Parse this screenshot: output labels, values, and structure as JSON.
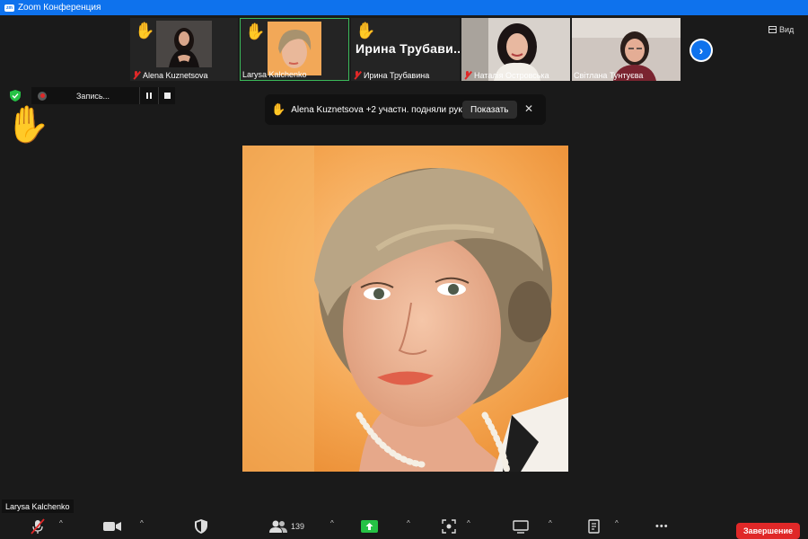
{
  "window": {
    "logo": "zm",
    "title": "Zoom Конференция"
  },
  "gallery": [
    {
      "name": "Alena Kuznetsova",
      "hand": "✋",
      "muted": true
    },
    {
      "name": "Larysa Kalchenko",
      "hand": "✋",
      "muted": false,
      "active": true
    },
    {
      "name": "Ирина Трубавина",
      "hand": "✋",
      "muted": true,
      "big_label": "Ирина Трубави..."
    },
    {
      "name": "Наталія Островська",
      "muted": true
    },
    {
      "name": "Світлана Тунтуєва",
      "muted": false
    }
  ],
  "view_button": {
    "label": "Вид",
    "icon": "grid-view-icon"
  },
  "next_button": {
    "icon": "chevron-right-icon",
    "glyph": "›"
  },
  "recording": {
    "label": "Запись..."
  },
  "raised_hand": "✋",
  "notification": {
    "hand": "✋",
    "text": "Alena Kuznetsova +2 участн. подняли руку",
    "button": "Показать",
    "close": "✕"
  },
  "speaker": {
    "name": "Larysa Kalchenko"
  },
  "toolbar": {
    "participants_count": "139",
    "caret": "^",
    "more": "•••",
    "end_label": "Завершение"
  },
  "colors": {
    "titlebar": "#0e72ed",
    "active_border": "#3bba5a",
    "muted": "#e02828",
    "end_button": "#e02828",
    "share": "#26c245",
    "security": "#26c245"
  }
}
